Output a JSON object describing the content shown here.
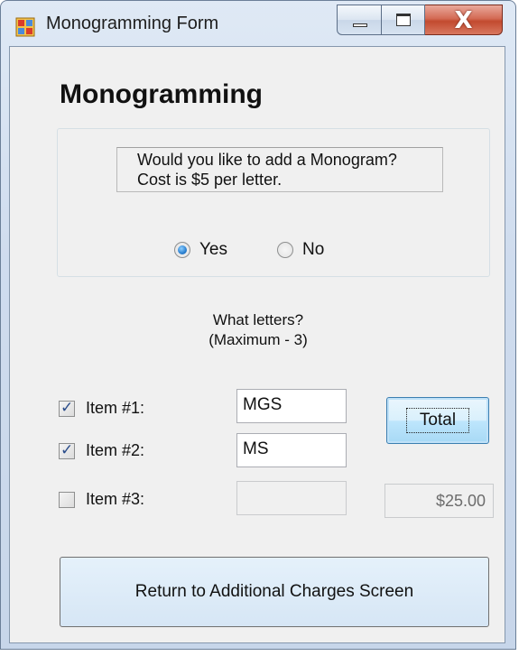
{
  "window": {
    "title": "Monogramming Form",
    "close_glyph": "X"
  },
  "form": {
    "heading": "Monogramming",
    "question_line1": "Would you like to add a Monogram?",
    "question_line2": "Cost is $5 per letter.",
    "radio_yes": "Yes",
    "radio_no": "No",
    "selected_option": "Yes",
    "letters_label_line1": "What letters?",
    "letters_label_line2": "(Maximum - 3)",
    "items": [
      {
        "label": "Item #1:",
        "checked": true,
        "value": "MGS"
      },
      {
        "label": "Item #2:",
        "checked": true,
        "value": "MS"
      },
      {
        "label": "Item #3:",
        "checked": false,
        "value": ""
      }
    ],
    "total_button": "Total",
    "total_value": "$25.00",
    "return_button": "Return to Additional Charges Screen"
  },
  "colors": {
    "accent": "#2a7fd0",
    "client_bg": "#f0f0f0",
    "close_button": "#c24a2f"
  }
}
